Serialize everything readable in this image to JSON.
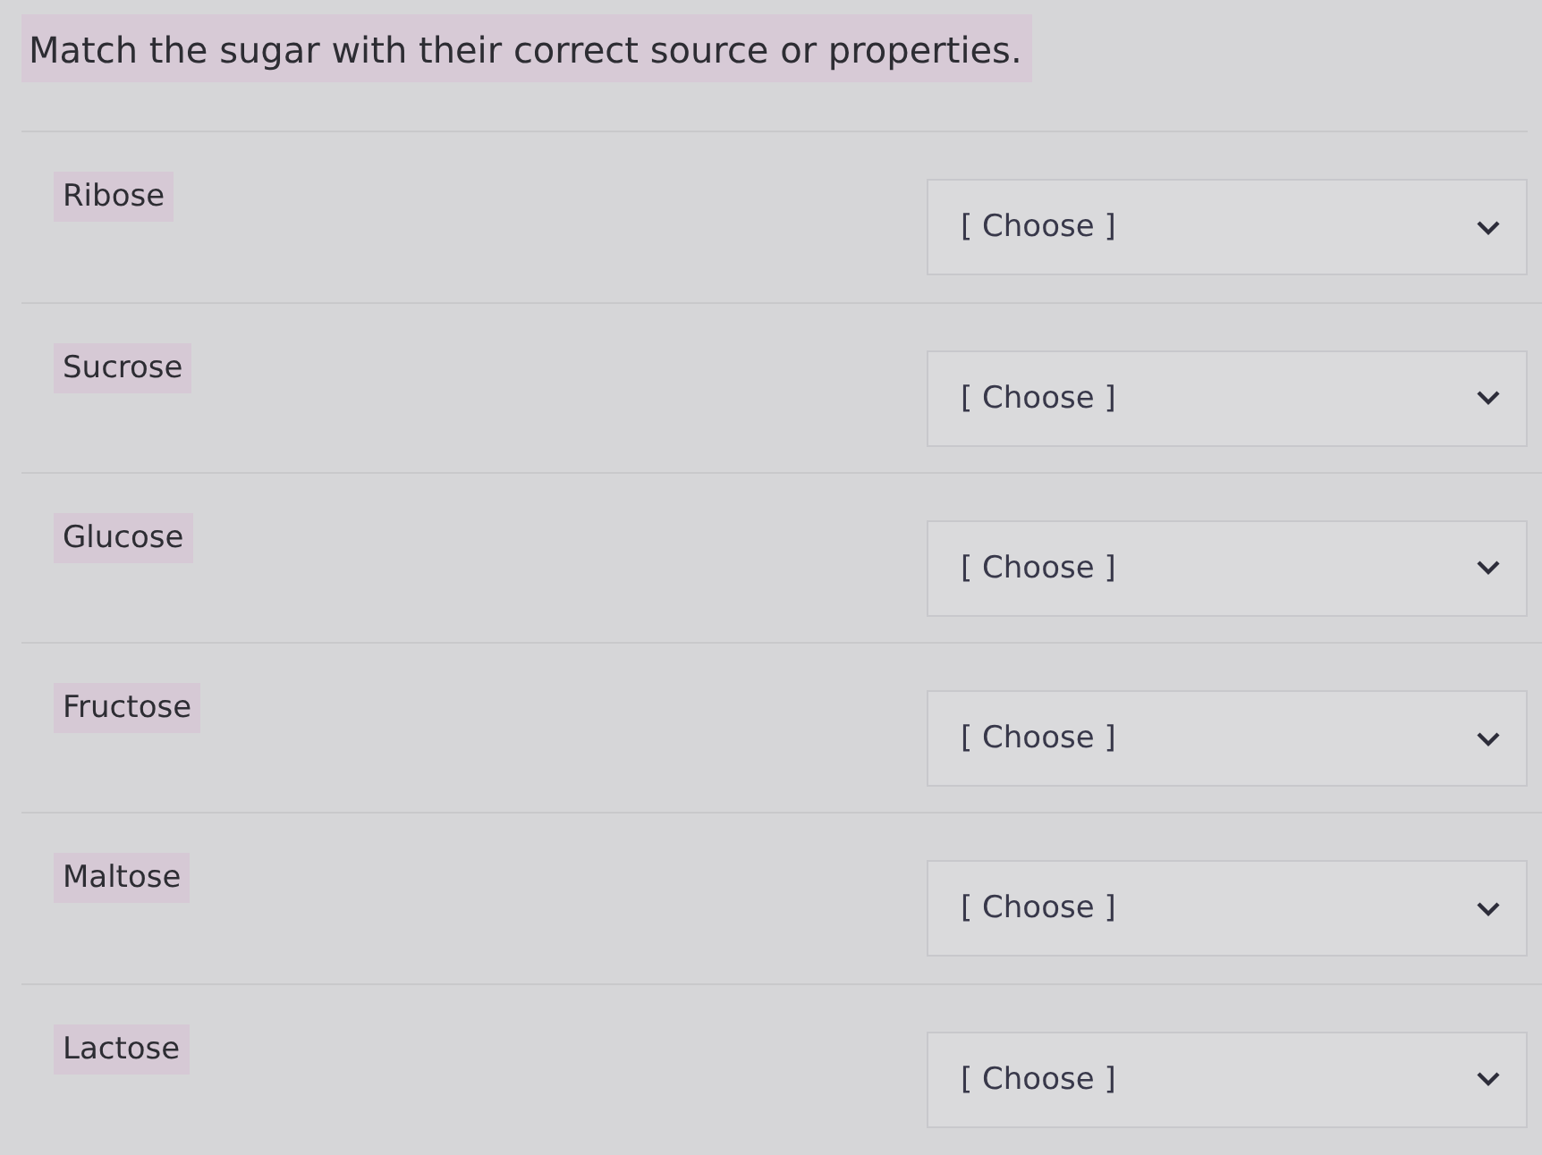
{
  "question": {
    "text": "Match the sugar with their correct source or properties."
  },
  "pairs": [
    {
      "prompt": "Ribose",
      "answer": "[ Choose ]"
    },
    {
      "prompt": "Sucrose",
      "answer": "[ Choose ]"
    },
    {
      "prompt": "Glucose",
      "answer": "[ Choose ]"
    },
    {
      "prompt": "Fructose",
      "answer": "[ Choose ]"
    },
    {
      "prompt": "Maltose",
      "answer": "[ Choose ]"
    },
    {
      "prompt": "Lactose",
      "answer": "[ Choose ]"
    }
  ]
}
